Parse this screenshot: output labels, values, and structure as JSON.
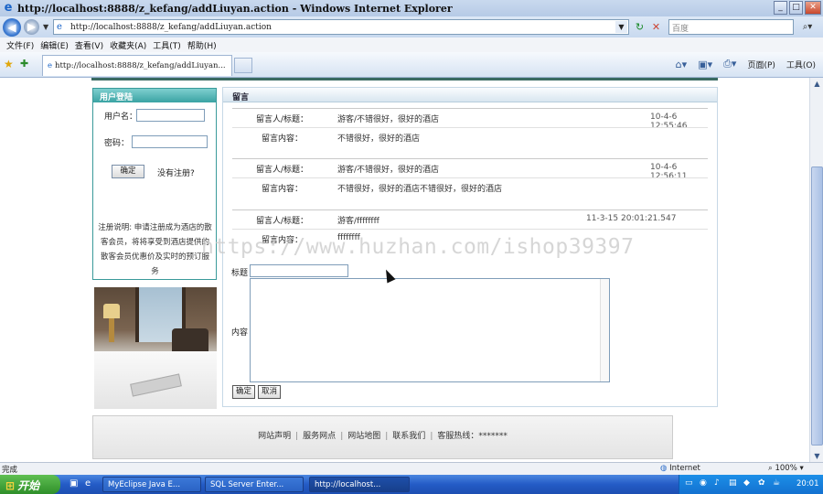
{
  "window": {
    "title": "http://localhost:8888/z_kefang/addLiuyan.action - Windows Internet Explorer",
    "btn_min": "_",
    "btn_max": "□",
    "btn_close": "✕"
  },
  "addressbar": {
    "url": "http://localhost:8888/z_kefang/addLiuyan.action",
    "search_placeholder": "百度"
  },
  "menu": [
    "文件(F)",
    "编辑(E)",
    "查看(V)",
    "收藏夹(A)",
    "工具(T)",
    "帮助(H)"
  ],
  "tab": {
    "label": "http://localhost:8888/z_kefang/addLiuyan..."
  },
  "commandbar": {
    "page": "页面(P)",
    "tools": "工具(O)"
  },
  "login": {
    "header": "用户登陆",
    "username_label": "用户名：",
    "password_label": "密码：",
    "confirm": "确定",
    "register": "没有注册?",
    "info": "注册说明: 申请注册成为酒店的散客会员，将将享受到酒店提供的散客会员优惠价及实时的预订服务"
  },
  "guestbook": {
    "header": "留言",
    "entries": [
      {
        "label_user": "留言人/标题：",
        "user_title": "游客/不错很好，很好的酒店",
        "time": "10-4-6 12:55:46",
        "label_content": "留言内容：",
        "content": "不错很好，很好的酒店"
      },
      {
        "label_user": "留言人/标题：",
        "user_title": "游客/不错很好，很好的酒店",
        "time": "10-4-6 12:56:11",
        "label_content": "留言内容：",
        "content": "不错很好，很好的酒店不错很好，很好的酒店"
      },
      {
        "label_user": "留言人/标题：",
        "user_title": "游客/ffffffff",
        "time": "11-3-15 20:01:21.547",
        "label_content": "留言内容：",
        "content": "ffffffff"
      }
    ],
    "form": {
      "title_label": "标题",
      "content_label": "内容",
      "submit": "确定",
      "cancel": "取消"
    }
  },
  "watermark": "https://www.huzhan.com/ishop39397",
  "footer": {
    "links": [
      "网站声明",
      "服务网点",
      "网站地图",
      "联系我们"
    ],
    "hotline": "客服热线：*******"
  },
  "statusbar": {
    "status": "完成",
    "zone": "Internet",
    "zoom": "100%"
  },
  "taskbar": {
    "start": "开始",
    "tasks": [
      "MyEclipse Java E...",
      "SQL Server Enter...",
      "http://localhost..."
    ],
    "clock": "20:01"
  }
}
